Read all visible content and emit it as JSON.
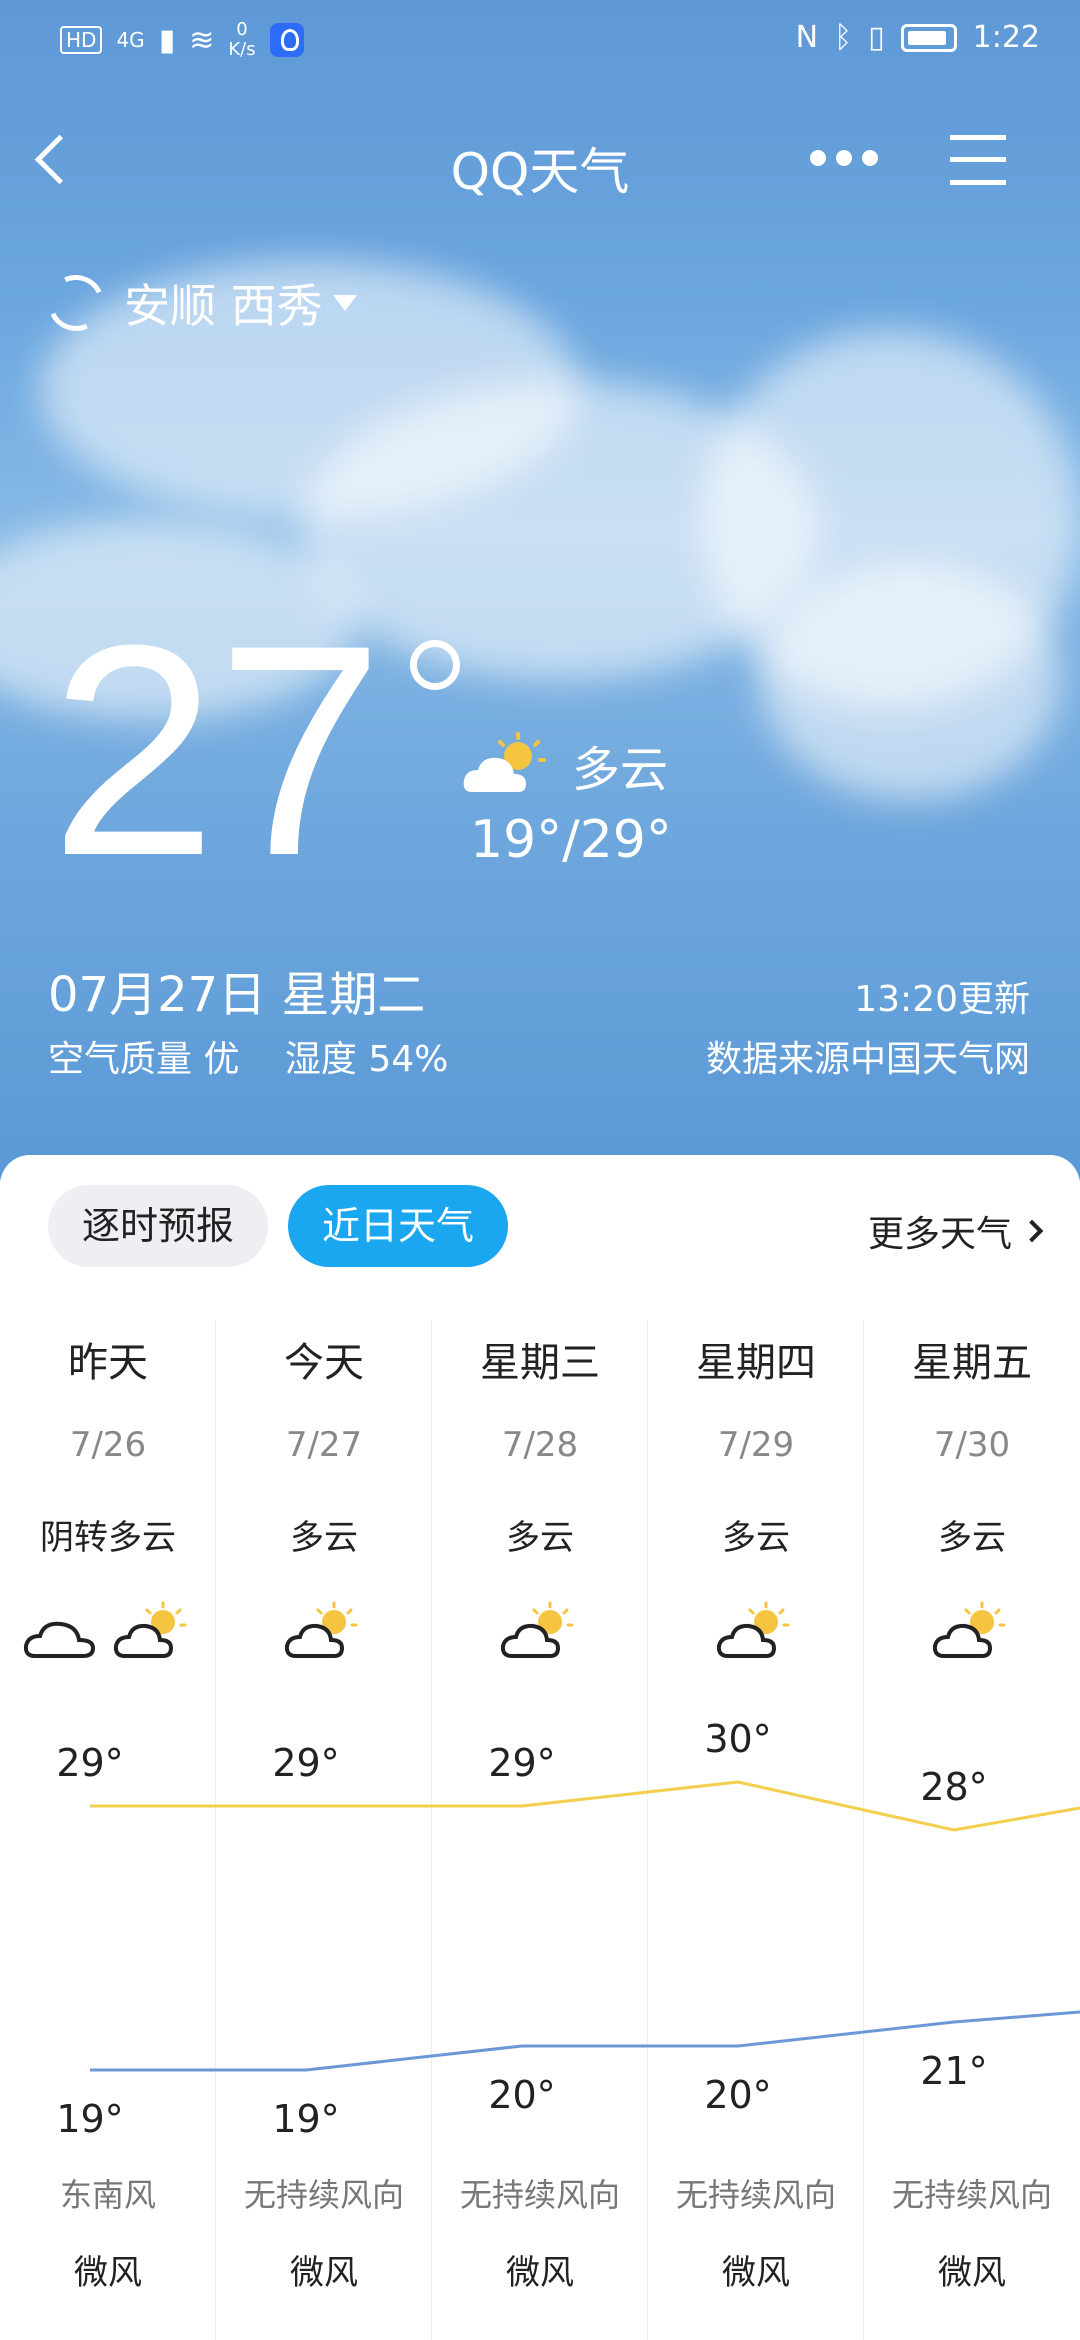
{
  "status": {
    "left_badges": [
      "HD",
      "4G"
    ],
    "net_speed_value": "0",
    "net_speed_unit": "K/s",
    "time": "1:22"
  },
  "header": {
    "app_title": "QQ天气",
    "location": "安顺 西秀"
  },
  "current": {
    "temperature": "27",
    "condition": "多云",
    "range": "19°/29°",
    "date": "07月27日 星期二",
    "air_quality": "空气质量 优",
    "humidity": "湿度 54%",
    "updated": "13:20更新",
    "source": "数据来源中国天气网"
  },
  "tabs": {
    "hourly": "逐时预报",
    "daily": "近日天气",
    "more": "更多天气"
  },
  "forecast": [
    {
      "name": "昨天",
      "date": "7/26",
      "condition": "阴转多云",
      "high": "29°",
      "low": "19°",
      "wind_dir": "东南风",
      "wind_level": "微风",
      "icons": [
        "cloud-icon",
        "partly-cloudy-icon"
      ]
    },
    {
      "name": "今天",
      "date": "7/27",
      "condition": "多云",
      "high": "29°",
      "low": "19°",
      "wind_dir": "无持续风向",
      "wind_level": "微风",
      "icons": [
        "partly-cloudy-icon"
      ]
    },
    {
      "name": "星期三",
      "date": "7/28",
      "condition": "多云",
      "high": "29°",
      "low": "20°",
      "wind_dir": "无持续风向",
      "wind_level": "微风",
      "icons": [
        "partly-cloudy-icon"
      ]
    },
    {
      "name": "星期四",
      "date": "7/29",
      "condition": "多云",
      "high": "30°",
      "low": "20°",
      "wind_dir": "无持续风向",
      "wind_level": "微风",
      "icons": [
        "partly-cloudy-icon"
      ]
    },
    {
      "name": "星期五",
      "date": "7/30",
      "condition": "多云",
      "high": "28°",
      "low": "21°",
      "wind_dir": "无持续风向",
      "wind_level": "微风",
      "icons": [
        "partly-cloudy-icon"
      ]
    }
  ],
  "chart_data": {
    "type": "line",
    "categories": [
      "7/26",
      "7/27",
      "7/28",
      "7/29",
      "7/30"
    ],
    "series": [
      {
        "values": [
          29,
          29,
          29,
          30,
          28
        ],
        "color": "#f3cf4d"
      },
      {
        "values": [
          19,
          19,
          20,
          20,
          21
        ],
        "color": "#6b97d6"
      }
    ]
  },
  "colors": {
    "accent": "#1aa7f0",
    "high_line": "#f3cf4d",
    "low_line": "#6b97d6"
  }
}
